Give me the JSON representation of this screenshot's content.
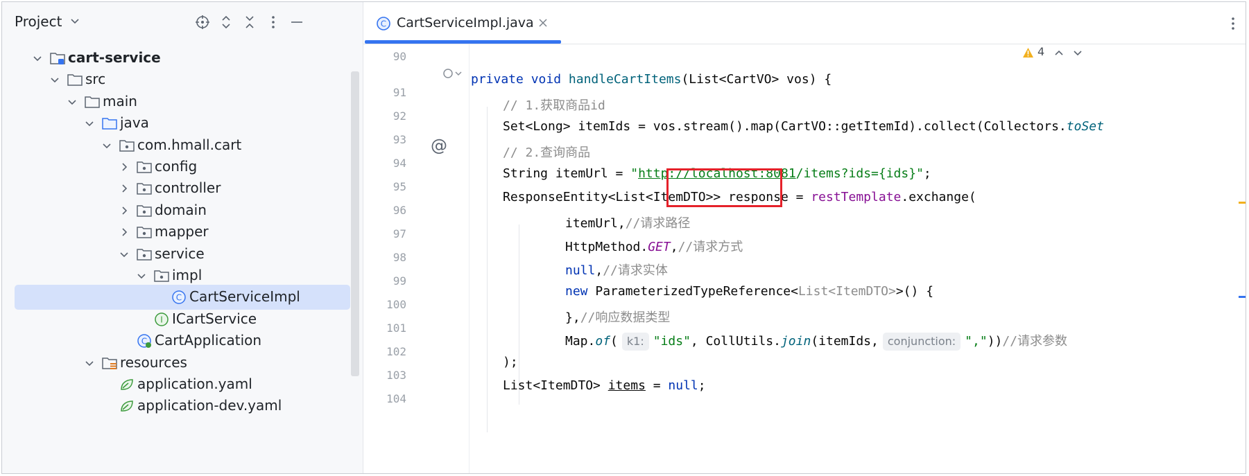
{
  "project": {
    "title": "Project",
    "tree": [
      {
        "label": "cart-service",
        "kind": "module",
        "bold": true,
        "expanded": true,
        "depth": 0
      },
      {
        "label": "src",
        "kind": "folder",
        "expanded": true,
        "depth": 1
      },
      {
        "label": "main",
        "kind": "folder",
        "expanded": true,
        "depth": 2
      },
      {
        "label": "java",
        "kind": "source-folder",
        "expanded": true,
        "depth": 3
      },
      {
        "label": "com.hmall.cart",
        "kind": "package",
        "expanded": true,
        "depth": 4
      },
      {
        "label": "config",
        "kind": "package",
        "expanded": false,
        "depth": 5
      },
      {
        "label": "controller",
        "kind": "package",
        "expanded": false,
        "depth": 5
      },
      {
        "label": "domain",
        "kind": "package",
        "expanded": false,
        "depth": 5
      },
      {
        "label": "mapper",
        "kind": "package",
        "expanded": false,
        "depth": 5
      },
      {
        "label": "service",
        "kind": "package",
        "expanded": true,
        "depth": 5
      },
      {
        "label": "impl",
        "kind": "package",
        "expanded": true,
        "depth": 6
      },
      {
        "label": "CartServiceImpl",
        "kind": "class",
        "depth": 7,
        "selected": true
      },
      {
        "label": "ICartService",
        "kind": "interface",
        "depth": 6
      },
      {
        "label": "CartApplication",
        "kind": "app-class",
        "depth": 5
      },
      {
        "label": "resources",
        "kind": "resources",
        "expanded": true,
        "depth": 3
      },
      {
        "label": "application.yaml",
        "kind": "yaml",
        "depth": 4
      },
      {
        "label": "application-dev.yaml",
        "kind": "yaml",
        "depth": 4
      }
    ]
  },
  "editor": {
    "tab_label": "CartServiceImpl.java",
    "warning_count": "4",
    "line_numbers": [
      "90",
      "91",
      "92",
      "93",
      "94",
      "95",
      "96",
      "97",
      "98",
      "99",
      "100",
      "101",
      "102",
      "103",
      "104"
    ],
    "code": {
      "l91": {
        "private": "private",
        "void": "void",
        "name": "handleCartItems",
        "rest": "(List<CartVO> vos) {"
      },
      "l92": "// 1.获取商品id",
      "l93": {
        "pre": "Set<Long> itemIds = vos.stream().map(CartVO::getItemId).collect(Collectors.",
        "tail": "toSet"
      },
      "l94": "// 2.查询商品",
      "l95": {
        "pre": "String itemUrl = ",
        "q1": "\"",
        "u1": "http://",
        "u2": "localhost:8081",
        "u3": "/items?ids=",
        "s4": "{ids}",
        "q2": "\"",
        "end": ";"
      },
      "l96": {
        "pre": "ResponseEntity<List<ItemDTO>> response = ",
        "fld": "restTemplate",
        "post": ".exchange("
      },
      "l97": {
        "pre": "itemUrl,",
        "cm": "//请求路径"
      },
      "l98": {
        "pre": "HttpMethod.",
        "fld": "GET",
        "post": ",",
        "cm": "//请求方式"
      },
      "l99": {
        "kw": "null",
        "post": ",",
        "cm": "//请求实体"
      },
      "l100": {
        "kw": "new",
        "mid": " ParameterizedTypeReference<",
        "gray": "List<ItemDTO>",
        "post": ">() {"
      },
      "l101": {
        "pre": "},",
        "cm": "//响应数据类型"
      },
      "l102": {
        "pre": "Map.",
        "fn": "of",
        "paren": "(",
        "hint1": "k1:",
        "s1": "\"ids\"",
        "mid": ", CollUtils.",
        "fn2": "join",
        "mid2": "(itemIds,",
        "hint2": "conjunction:",
        "s2": "\",\"",
        "post": "))",
        "cm": "//请求参数"
      },
      "l103": ");",
      "l104": {
        "pre": "List<ItemDTO> ",
        "var": "items",
        "mid": " = ",
        "kw": "null",
        "post": ";"
      }
    }
  },
  "colors": {
    "accent": "#3574f0",
    "highlight_box": "#e5212a",
    "selection": "#d5e1fb"
  }
}
